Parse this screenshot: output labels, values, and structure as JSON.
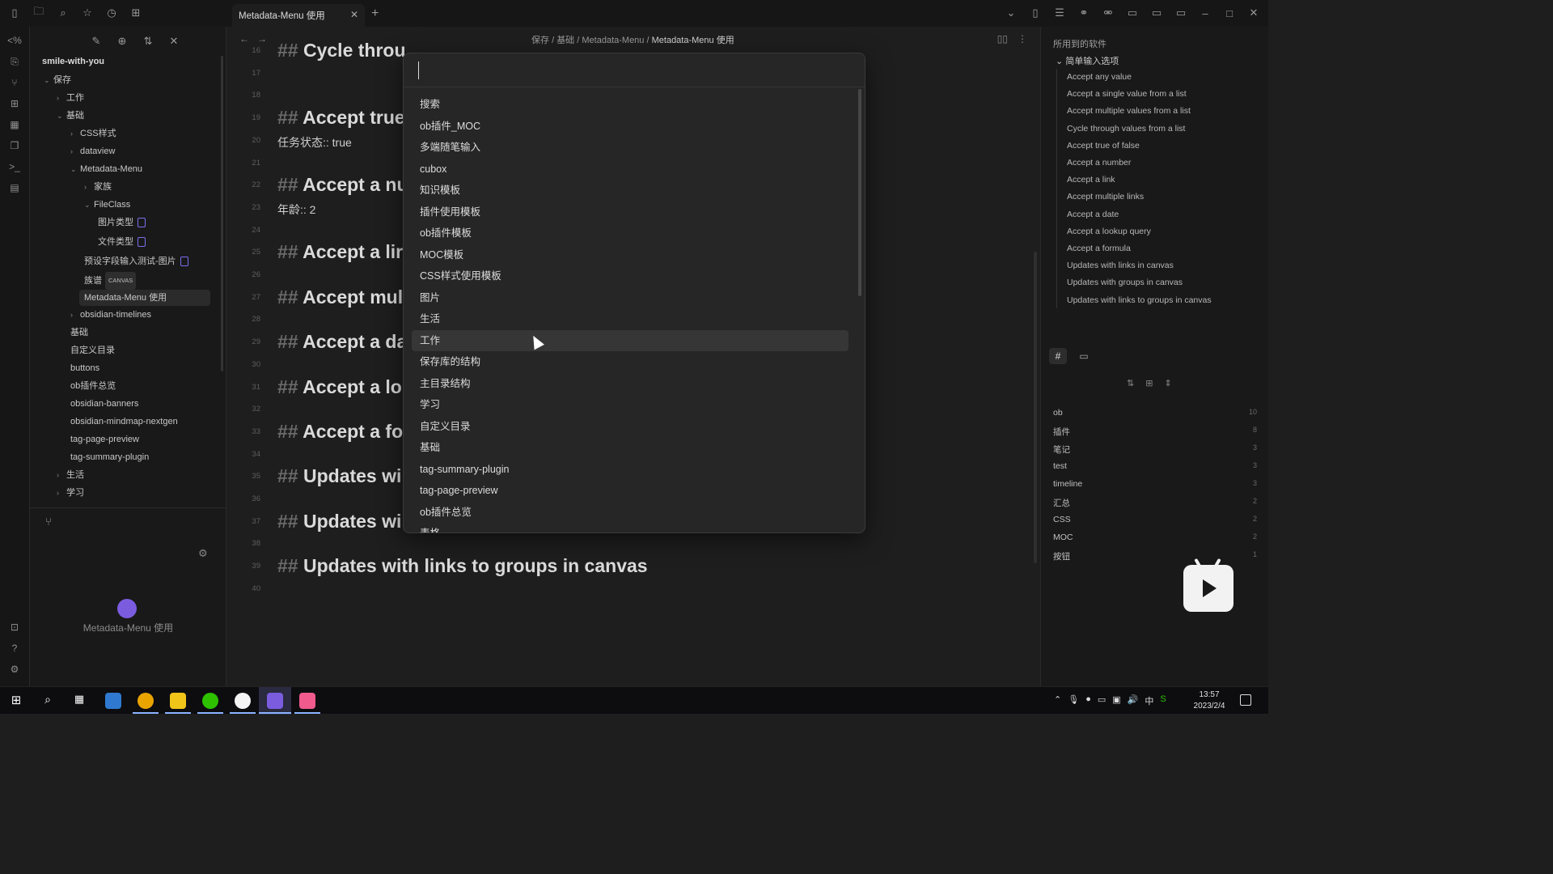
{
  "tab": {
    "title": "Metadata-Menu 使用"
  },
  "breadcrumb": {
    "parts": [
      "保存",
      "基础",
      "Metadata-Menu",
      "Metadata-Menu 使用"
    ],
    "sep": "/"
  },
  "vault": {
    "name": "smile-with-you"
  },
  "tree": {
    "items": [
      {
        "label": "保存"
      },
      {
        "label": "工作"
      },
      {
        "label": "基础"
      },
      {
        "label": "CSS样式"
      },
      {
        "label": "dataview"
      },
      {
        "label": "Metadata-Menu"
      },
      {
        "label": "家族"
      },
      {
        "label": "FileClass"
      },
      {
        "label": "图片类型"
      },
      {
        "label": "文件类型"
      },
      {
        "label": "预设字段输入测试-图片"
      },
      {
        "label": "族谱",
        "badge": "CANVAS"
      },
      {
        "label": "Metadata-Menu 使用"
      },
      {
        "label": "obsidian-timelines"
      },
      {
        "label": "基础"
      },
      {
        "label": "自定义目录"
      },
      {
        "label": "buttons"
      },
      {
        "label": "ob插件总览"
      },
      {
        "label": "obsidian-banners"
      },
      {
        "label": "obsidian-mindmap-nextgen"
      },
      {
        "label": "tag-page-preview"
      },
      {
        "label": "tag-summary-plugin"
      },
      {
        "label": "生活"
      },
      {
        "label": "学习"
      }
    ]
  },
  "graph": {
    "label": "Metadata-Menu 使用"
  },
  "editor": {
    "lines": [
      {
        "no": "16",
        "h": "Cycle throu"
      },
      {
        "no": "17"
      },
      {
        "no": "18"
      },
      {
        "no": "19",
        "h": "Accept true"
      },
      {
        "no": "20",
        "p": "任务状态:: true"
      },
      {
        "no": "21"
      },
      {
        "no": "22",
        "h": "Accept a nu"
      },
      {
        "no": "23",
        "p": "年龄:: 2"
      },
      {
        "no": "24"
      },
      {
        "no": "25",
        "h": "Accept a lir"
      },
      {
        "no": "26"
      },
      {
        "no": "27",
        "h": "Accept mul"
      },
      {
        "no": "28"
      },
      {
        "no": "29",
        "h": "Accept a da"
      },
      {
        "no": "30"
      },
      {
        "no": "31",
        "h": "Accept a lo"
      },
      {
        "no": "32"
      },
      {
        "no": "33",
        "h": "Accept a fo"
      },
      {
        "no": "34"
      },
      {
        "no": "35",
        "h": "Updates wi"
      },
      {
        "no": "36"
      },
      {
        "no": "37",
        "h": "Updates wi"
      },
      {
        "no": "38"
      },
      {
        "no": "39",
        "h": "Updates with links to groups in canvas"
      },
      {
        "no": "40"
      }
    ],
    "hash": "##"
  },
  "switcher": {
    "input_value": "",
    "options": [
      "搜索",
      "ob插件_MOC",
      "多端随笔输入",
      "cubox",
      "知识模板",
      "插件使用模板",
      "ob插件模板",
      "MOC模板",
      "CSS样式使用模板",
      "图片",
      "生活",
      "工作",
      "保存库的结构",
      "主目录结构",
      "学习",
      "自定义目录",
      "基础",
      "tag-summary-plugin",
      "tag-page-preview",
      "ob插件总览",
      "表格"
    ],
    "selected_index": 11
  },
  "outline": {
    "title": "所用到的软件",
    "parent": "简单输入选项",
    "items": [
      "Accept any value",
      "Accept a single value from a list",
      "Accept multiple values from a list",
      "Cycle through values from a list",
      "Accept true of false",
      "Accept a number",
      "Accept a link",
      "Accept multiple links",
      "Accept a date",
      "Accept a lookup query",
      "Accept a formula",
      "Updates with links in canvas",
      "Updates with groups in canvas",
      "Updates with links to groups in canvas"
    ]
  },
  "tags": [
    {
      "name": "ob",
      "count": "10"
    },
    {
      "name": "插件",
      "count": "8"
    },
    {
      "name": "笔记",
      "count": "3"
    },
    {
      "name": "test",
      "count": "3"
    },
    {
      "name": "timeline",
      "count": "3"
    },
    {
      "name": "汇总",
      "count": "2"
    },
    {
      "name": "CSS",
      "count": "2"
    },
    {
      "name": "MOC",
      "count": "2"
    },
    {
      "name": "按钮",
      "count": "1"
    }
  ],
  "taskbar": {
    "time": "13:57",
    "date": "2023/2/4",
    "ime": "中"
  },
  "colors": {
    "accent": "#7b5cdf",
    "bg": "#1e1e1e",
    "panel": "#191919"
  }
}
